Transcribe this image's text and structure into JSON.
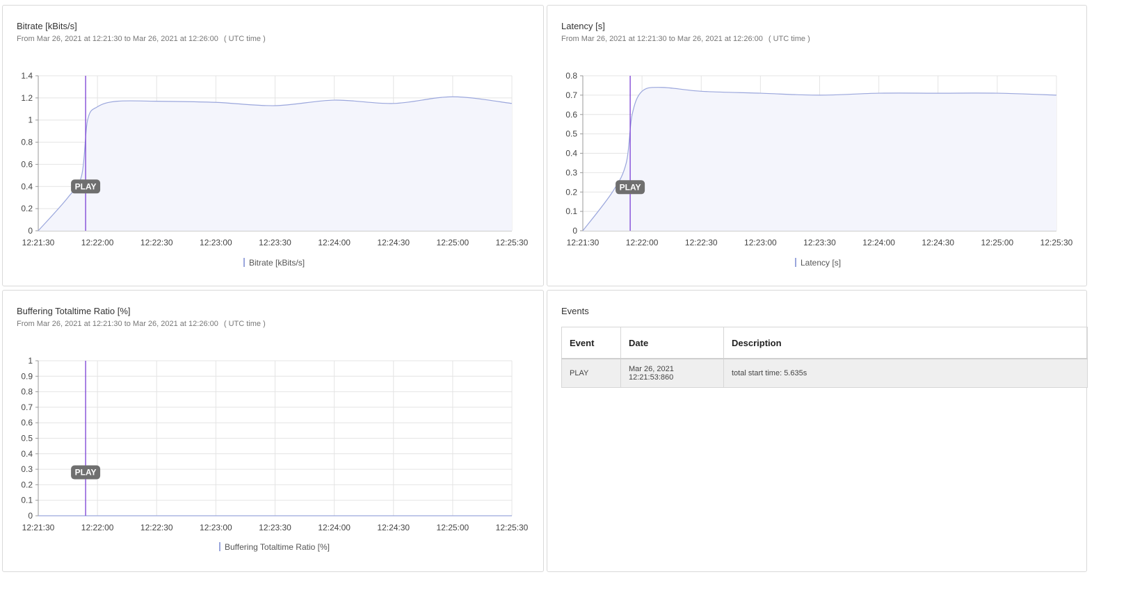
{
  "panels": {
    "bitrate": {
      "title": "Bitrate [kBits/s]",
      "subtitle": "From Mar 26, 2021 at 12:21:30 to Mar 26, 2021 at 12:26:00",
      "timezone": "( UTC time )",
      "legend": "Bitrate [kBits/s]"
    },
    "latency": {
      "title": "Latency [s]",
      "subtitle": "From Mar 26, 2021 at 12:21:30 to Mar 26, 2021 at 12:26:00",
      "timezone": "( UTC time )",
      "legend": "Latency [s]"
    },
    "buffering": {
      "title": "Buffering Totaltime Ratio [%]",
      "subtitle": "From Mar 26, 2021 at 12:21:30 to Mar 26, 2021 at 12:26:00",
      "timezone": "( UTC time )",
      "legend": "Buffering Totaltime Ratio [%]"
    },
    "events": {
      "title": "Events",
      "columns": [
        "Event",
        "Date",
        "Description"
      ],
      "rows": [
        [
          "PLAY",
          "Mar 26, 2021 12:21:53:860",
          "total start time: 5.635s"
        ]
      ]
    }
  },
  "colors": {
    "series_line": "#9aa6dc",
    "series_fill": "#f4f5fc",
    "marker_line": "#7a3fd4",
    "marker_label_bg": "#6f6f6f",
    "grid": "#e4e4e4",
    "axis": "#999999"
  },
  "chart_data": [
    {
      "id": "bitrate",
      "type": "area",
      "title": "Bitrate [kBits/s]",
      "x_ticks": [
        "12:21:30",
        "12:22:00",
        "12:22:30",
        "12:23:00",
        "12:23:30",
        "12:24:00",
        "12:24:30",
        "12:25:00",
        "12:25:30"
      ],
      "y_ticks": [
        "0",
        "0.2",
        "0.4",
        "0.6",
        "0.8",
        "1",
        "1.2",
        "1.4"
      ],
      "xlim": [
        "12:21:30",
        "12:25:30"
      ],
      "ylim": [
        0,
        1.4
      ],
      "grid": true,
      "legend_position": "bottom",
      "series": [
        {
          "name": "Bitrate [kBits/s]",
          "x": [
            "12:21:30",
            "12:21:45",
            "12:21:52",
            "12:21:55",
            "12:22:00",
            "12:22:10",
            "12:22:30",
            "12:23:00",
            "12:23:30",
            "12:24:00",
            "12:24:30",
            "12:25:00",
            "12:25:30"
          ],
          "y": [
            0,
            0.3,
            0.5,
            1.0,
            1.12,
            1.17,
            1.17,
            1.16,
            1.13,
            1.18,
            1.15,
            1.21,
            1.15
          ]
        }
      ],
      "events": [
        {
          "x": "12:21:54",
          "label": "PLAY",
          "label_y": 0.4
        }
      ]
    },
    {
      "id": "latency",
      "type": "area",
      "title": "Latency [s]",
      "x_ticks": [
        "12:21:30",
        "12:22:00",
        "12:22:30",
        "12:23:00",
        "12:23:30",
        "12:24:00",
        "12:24:30",
        "12:25:00",
        "12:25:30"
      ],
      "y_ticks": [
        "0",
        "0.1",
        "0.2",
        "0.3",
        "0.4",
        "0.5",
        "0.6",
        "0.7",
        "0.8"
      ],
      "xlim": [
        "12:21:30",
        "12:25:30"
      ],
      "ylim": [
        0,
        0.8
      ],
      "grid": true,
      "legend_position": "bottom",
      "series": [
        {
          "name": "Latency [s]",
          "x": [
            "12:21:30",
            "12:21:45",
            "12:21:52",
            "12:21:55",
            "12:22:00",
            "12:22:10",
            "12:22:30",
            "12:23:00",
            "12:23:30",
            "12:24:00",
            "12:24:30",
            "12:25:00",
            "12:25:30"
          ],
          "y": [
            0,
            0.2,
            0.35,
            0.6,
            0.72,
            0.74,
            0.72,
            0.71,
            0.7,
            0.71,
            0.71,
            0.71,
            0.7
          ]
        }
      ],
      "events": [
        {
          "x": "12:21:54",
          "label": "PLAY",
          "label_y": 0.225
        }
      ]
    },
    {
      "id": "buffering",
      "type": "line",
      "title": "Buffering Totaltime Ratio [%]",
      "x_ticks": [
        "12:21:30",
        "12:22:00",
        "12:22:30",
        "12:23:00",
        "12:23:30",
        "12:24:00",
        "12:24:30",
        "12:25:00",
        "12:25:30"
      ],
      "y_ticks": [
        "0",
        "0.1",
        "0.2",
        "0.3",
        "0.4",
        "0.5",
        "0.6",
        "0.7",
        "0.8",
        "0.9",
        "1"
      ],
      "xlim": [
        "12:21:30",
        "12:25:30"
      ],
      "ylim": [
        0,
        1
      ],
      "grid": true,
      "legend_position": "bottom",
      "series": [
        {
          "name": "Buffering Totaltime Ratio [%]",
          "x": [
            "12:21:30",
            "12:25:30"
          ],
          "y": [
            0,
            0
          ]
        }
      ],
      "events": [
        {
          "x": "12:21:54",
          "label": "PLAY",
          "label_y": 0.28
        }
      ]
    }
  ]
}
